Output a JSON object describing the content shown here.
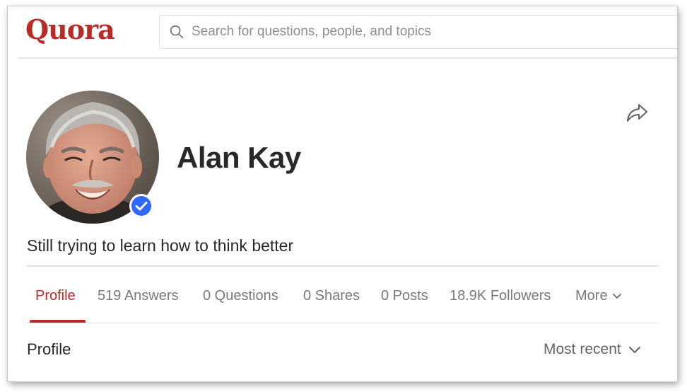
{
  "header": {
    "logo_text": "Quora",
    "search_placeholder": "Search for questions, people, and topics",
    "search_value": ""
  },
  "profile": {
    "name": "Alan Kay",
    "tagline": "Still trying to learn how to think better",
    "verified": true,
    "avatar_icon": "avatar-photo",
    "share_icon": "share-arrow-icon"
  },
  "tabs": [
    {
      "label": "Profile",
      "active": true
    },
    {
      "label": "519 Answers"
    },
    {
      "label": "0 Questions"
    },
    {
      "label": "0 Shares"
    },
    {
      "label": "0 Posts"
    },
    {
      "label": "18.9K Followers"
    },
    {
      "label": "More"
    }
  ],
  "section": {
    "title": "Profile",
    "sort_label": "Most recent"
  },
  "colors": {
    "brand": "#b92b27",
    "verified_badge": "#2e69ff",
    "muted_text": "#77797b"
  }
}
